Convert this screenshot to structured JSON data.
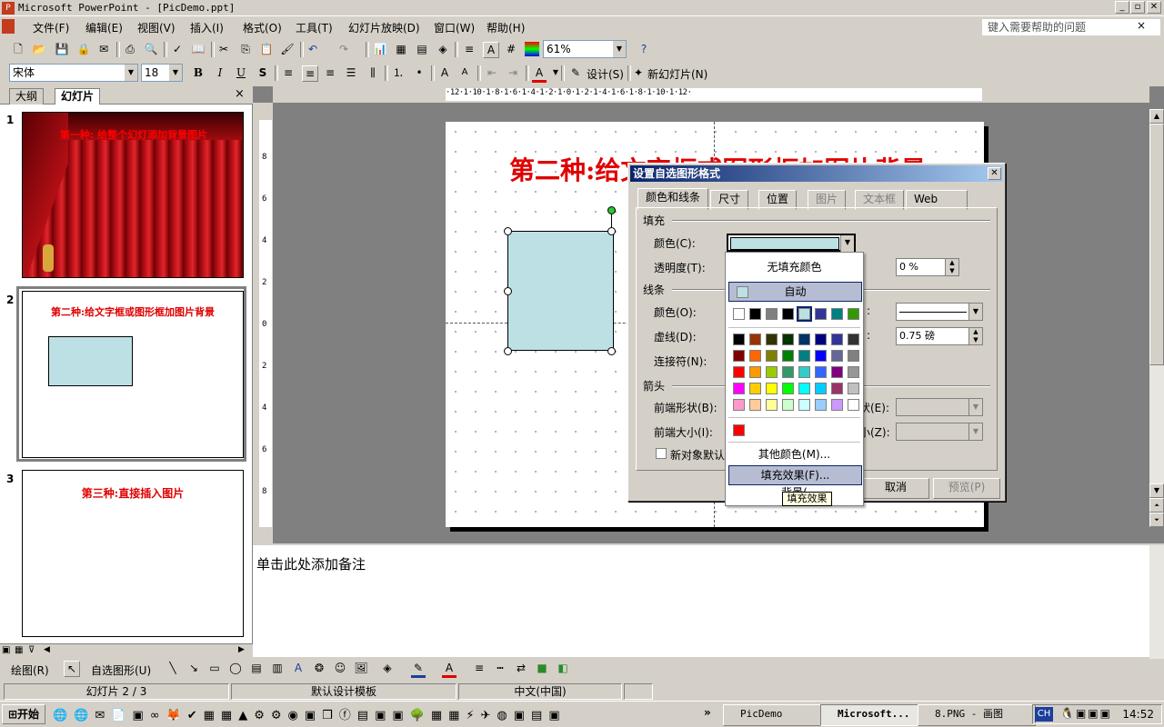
{
  "window": {
    "title": "Microsoft PowerPoint - [PicDemo.ppt]",
    "min": "_",
    "max": "▫",
    "close": "✕"
  },
  "menu": {
    "items": [
      "文件(F)",
      "编辑(E)",
      "视图(V)",
      "插入(I)",
      "格式(O)",
      "工具(T)",
      "幻灯片放映(D)",
      "窗口(W)",
      "帮助(H)"
    ],
    "help_placeholder": "键入需要帮助的问题",
    "help_close": "×"
  },
  "toolbar": {
    "zoom": "61%",
    "font": "宋体",
    "size": "18",
    "bold": "B",
    "italic": "I",
    "underline": "U",
    "shadow": "S",
    "design": "设计(S)",
    "new_slide": "新幻灯片(N)"
  },
  "left_pane": {
    "tab_outline": "大纲",
    "tab_slides": "幻灯片",
    "close": "×",
    "slides": [
      {
        "num": "1",
        "title": "第一种: 给整个幻灯添加背景图片"
      },
      {
        "num": "2",
        "title": "第二种:给文字框或图形框加图片背景"
      },
      {
        "num": "3",
        "title": "第三种:直接插入图片"
      }
    ]
  },
  "ruler": {
    "h": "·12·1·10·1·8·1·6·1·4·1·2·1·0·1·2·1·4·1·6·1·8·1·10·1·12·",
    "v": [
      "8",
      "6",
      "4",
      "2",
      "0",
      "2",
      "4",
      "6",
      "8"
    ]
  },
  "slide": {
    "title": "第二种:给文字框或图形框加图片背景"
  },
  "notes": {
    "placeholder": "单击此处添加备注"
  },
  "dialog": {
    "title": "设置自选图形格式",
    "tabs": [
      "颜色和线条",
      "尺寸",
      "位置",
      "图片",
      "文本框",
      "Web"
    ],
    "fill": {
      "group": "填充",
      "color_label": "颜色(C):",
      "transparency_label": "透明度(T):",
      "transparency_value": "0 %"
    },
    "line": {
      "group": "线条",
      "color_label": "颜色(O):",
      "dash_label": "虚线(D):",
      "connector_label": "连接符(N):",
      "weight_value": "0.75 磅"
    },
    "arrows": {
      "group": "箭头",
      "begin_style_label": "前端形状(B):",
      "begin_size_label": "前端大小(I):",
      "end_style_label_tail": "状(E):",
      "end_size_label_tail": "小(Z):"
    },
    "default_checkbox": "新对象默认值",
    "cancel": "取消",
    "preview": "预览(P)",
    "fill_color": "#bde0e5"
  },
  "color_popup": {
    "no_fill": "无填充颜色",
    "automatic": "自动",
    "more_colors": "其他颜色(M)...",
    "fill_effects": "填充效果(F)...",
    "background_partial": "背景(",
    "tooltip": "填充效果",
    "recent_colors": [
      "#ffffff",
      "#000000",
      "#808080",
      "#000000",
      "#bde0e5",
      "#333399",
      "#008080",
      "#339900"
    ],
    "palette": [
      "#000000",
      "#993300",
      "#333300",
      "#003300",
      "#003366",
      "#000080",
      "#333399",
      "#333333",
      "#800000",
      "#ff6600",
      "#808000",
      "#008000",
      "#008080",
      "#0000ff",
      "#666699",
      "#808080",
      "#ff0000",
      "#ff9900",
      "#99cc00",
      "#339966",
      "#33cccc",
      "#3366ff",
      "#800080",
      "#969696",
      "#ff00ff",
      "#ffcc00",
      "#ffff00",
      "#00ff00",
      "#00ffff",
      "#00ccff",
      "#993366",
      "#c0c0c0",
      "#ff99cc",
      "#ffcc99",
      "#ffff99",
      "#ccffcc",
      "#ccffff",
      "#99ccff",
      "#cc99ff",
      "#ffffff"
    ],
    "scheme_extra": [
      "#ff0000"
    ]
  },
  "draw_bar": {
    "draw": "绘图(R)",
    "autoshapes": "自选图形(U)"
  },
  "status": {
    "slide": "幻灯片 2 / 3",
    "template": "默认设计模板",
    "lang": "中文(中国)"
  },
  "taskbar": {
    "start": "开始",
    "tasks": [
      "PicDemo",
      "Microsoft...",
      "8.PNG - 画图"
    ],
    "ime": "CH",
    "clock": "14:52"
  }
}
